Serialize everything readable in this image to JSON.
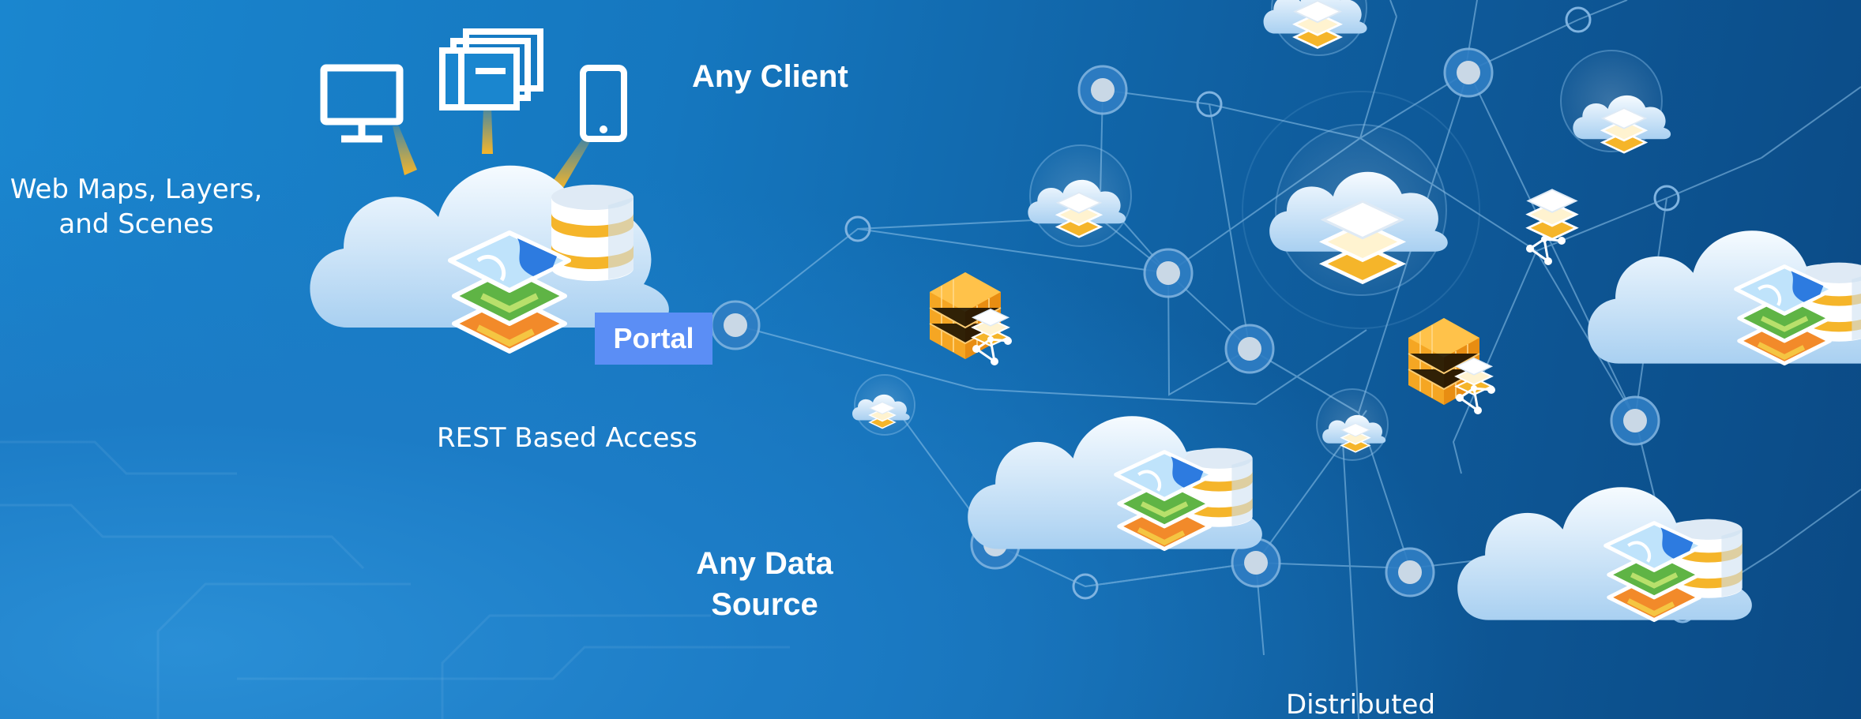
{
  "labels": {
    "any_client": "Any Client",
    "web_maps": "Web Maps, Layers,",
    "web_maps_2": "and Scenes",
    "portal": "Portal",
    "rest": "REST Based Access",
    "any_data_1": "Any Data",
    "any_data_2": "Source",
    "distributed": "Distributed"
  },
  "colors": {
    "accent_yellow": "#f5b52a",
    "portal_bg": "#5b8ef5",
    "map_green": "#5fb445",
    "map_orange": "#f28a2a",
    "map_blue": "#2d7be0",
    "node_fill": "#c9d8e6"
  },
  "icons": [
    "desktop-monitor-icon",
    "multi-window-icon",
    "smartphone-icon",
    "cloud-icon",
    "database-icon",
    "map-layers-icon",
    "data-cube-icon",
    "network-node-icon"
  ]
}
